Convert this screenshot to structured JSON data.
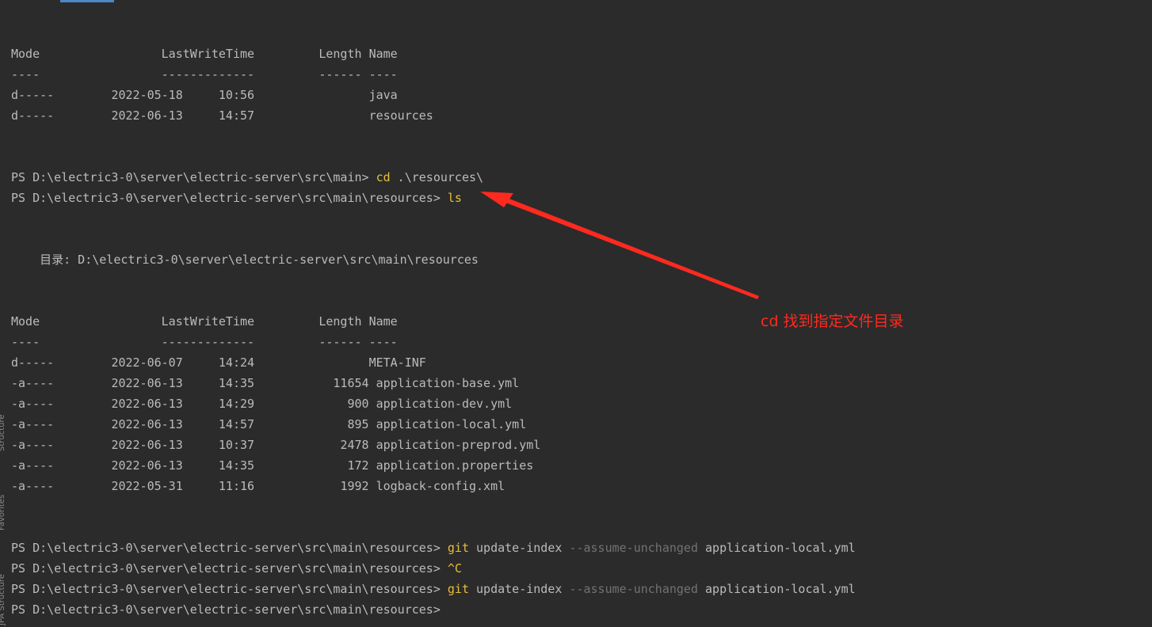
{
  "side_labels": [
    "Structure",
    "Favorites",
    "JPA Structure"
  ],
  "listing1": {
    "header": [
      "Mode",
      "LastWriteTime",
      "Length",
      "Name"
    ],
    "dashes": [
      "----",
      "-------------",
      "------",
      "----"
    ],
    "rows": [
      {
        "mode": "d-----",
        "date": "2022-05-18",
        "time": "10:56",
        "length": "",
        "name": "java"
      },
      {
        "mode": "d-----",
        "date": "2022-06-13",
        "time": "14:57",
        "length": "",
        "name": "resources"
      }
    ]
  },
  "prompt_main": "PS D:\\electric3-0\\server\\electric-server\\src\\main> ",
  "prompt_res": "PS D:\\electric3-0\\server\\electric-server\\src\\main\\resources> ",
  "cmd_cd": {
    "cmd": "cd",
    "arg": " .\\resources\\"
  },
  "cmd_ls": "ls",
  "directory_line": "    目录: D:\\electric3-0\\server\\electric-server\\src\\main\\resources",
  "listing2": {
    "header": [
      "Mode",
      "LastWriteTime",
      "Length",
      "Name"
    ],
    "dashes": [
      "----",
      "-------------",
      "------",
      "----"
    ],
    "rows": [
      {
        "mode": "d-----",
        "date": "2022-06-07",
        "time": "14:24",
        "length": "",
        "name": "META-INF"
      },
      {
        "mode": "-a----",
        "date": "2022-06-13",
        "time": "14:35",
        "length": "11654",
        "name": "application-base.yml"
      },
      {
        "mode": "-a----",
        "date": "2022-06-13",
        "time": "14:29",
        "length": "900",
        "name": "application-dev.yml"
      },
      {
        "mode": "-a----",
        "date": "2022-06-13",
        "time": "14:57",
        "length": "895",
        "name": "application-local.yml"
      },
      {
        "mode": "-a----",
        "date": "2022-06-13",
        "time": "10:37",
        "length": "2478",
        "name": "application-preprod.yml"
      },
      {
        "mode": "-a----",
        "date": "2022-06-13",
        "time": "14:35",
        "length": "172",
        "name": "application.properties"
      },
      {
        "mode": "-a----",
        "date": "2022-05-31",
        "time": "11:16",
        "length": "1992",
        "name": "logback-config.xml"
      }
    ]
  },
  "git_cmd": {
    "cmd": "git",
    "sub": " update-index ",
    "opt": "--assume-unchanged",
    "file": " application-local.yml"
  },
  "ctrl_c": "^C",
  "annotation_text": "cd 找到指定文件目录",
  "colors": {
    "background": "#2b2b2b",
    "text": "#bbbbbb",
    "command": "#e8bf3a",
    "option": "#727272",
    "annotation": "#ff2a1f"
  }
}
